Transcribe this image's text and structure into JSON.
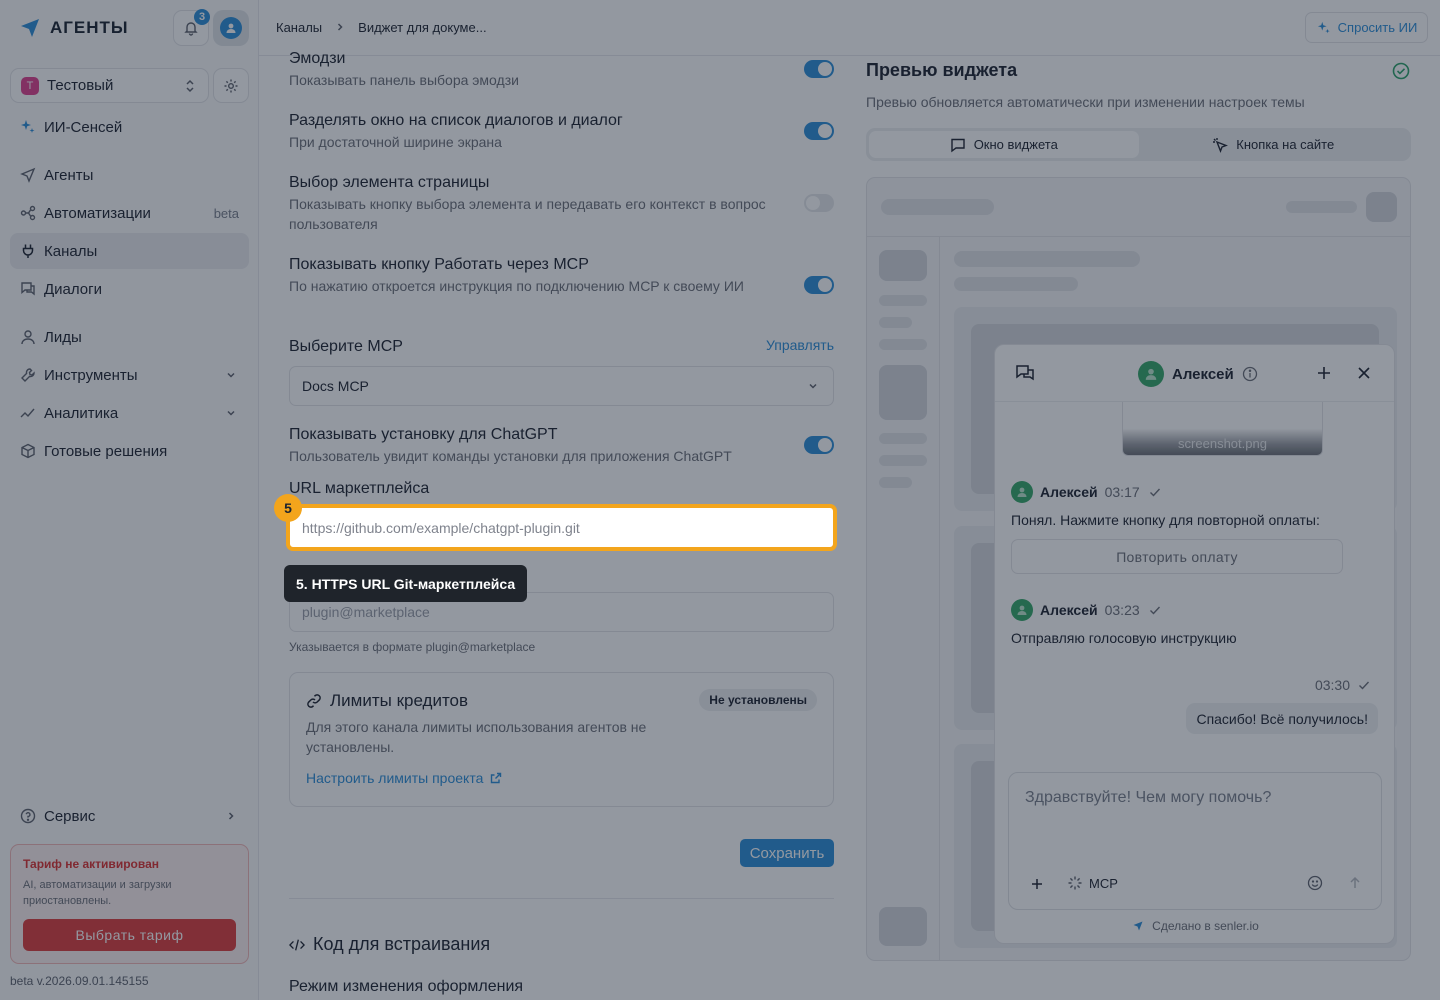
{
  "brand": {
    "name": "АГЕНТЫ",
    "notifications_count": "3"
  },
  "project": {
    "letter": "Т",
    "name": "Тестовый"
  },
  "sidebar": {
    "ai_item": "ИИ-Сенсей",
    "items": [
      {
        "label": "Агенты",
        "icon": "agent-icon"
      },
      {
        "label": "Автоматизации",
        "tag": "beta",
        "icon": "automation-icon"
      },
      {
        "label": "Каналы",
        "icon": "plug-icon",
        "active": true
      },
      {
        "label": "Диалоги",
        "icon": "chat-icon"
      },
      {
        "label": "Лиды",
        "icon": "user-icon"
      },
      {
        "label": "Инструменты",
        "icon": "tools-icon"
      },
      {
        "label": "Аналитика",
        "icon": "analytics-icon"
      },
      {
        "label": "Готовые решения",
        "icon": "box-icon"
      }
    ],
    "service": "Сервис",
    "tariff": {
      "title": "Тариф не активирован",
      "text": "AI, автоматизации и загрузки приостановлены.",
      "button": "Выбрать тариф"
    },
    "version": "beta v.2026.09.01.145155"
  },
  "topbar": {
    "breadcrumb": [
      "Каналы",
      "Виджет для докуме..."
    ],
    "ask_ai": "Спросить ИИ"
  },
  "settings": {
    "emoji": {
      "title": "Эмодзи",
      "desc": "Показывать панель выбора эмодзи",
      "on": true
    },
    "split": {
      "title": "Разделять окно на список диалогов и диалог",
      "desc": "При достаточной ширине экрана",
      "on": true
    },
    "element_pick": {
      "title": "Выбор элемента страницы",
      "desc": "Показывать кнопку выбора элемента и передавать его контекст в вопрос пользователя",
      "on": false
    },
    "mcp_button": {
      "title": "Показывать кнопку Работать через MCP",
      "desc": "По нажатию откроется инструкция по подключению MCP к своему ИИ",
      "on": true
    },
    "mcp_select": {
      "label": "Выберите MCP",
      "manage": "Управлять",
      "value": "Docs MCP"
    },
    "chatgpt": {
      "title": "Показывать установку для ChatGPT",
      "desc": "Пользователь увидит команды установки для приложения ChatGPT",
      "on": true
    },
    "marketplace_url": {
      "label": "URL маркетплейса",
      "placeholder": "https://github.com/example/chatgpt-plugin.git"
    },
    "plugin": {
      "placeholder": "plugin@marketplace",
      "hint": "Указывается в формате plugin@marketplace"
    },
    "limits": {
      "title": "Лимиты кредитов",
      "badge": "Не установлены",
      "desc": "Для этого канала лимиты использования агентов не установлены.",
      "link": "Настроить лимиты проекта"
    },
    "save": "Сохранить",
    "embed_title": "Код для встраивания",
    "mode_title": "Режим изменения оформления"
  },
  "preview": {
    "title": "Превью виджета",
    "desc": "Превью обновляется автоматически при изменении настроек темы",
    "tabs": [
      "Окно виджета",
      "Кнопка на сайте"
    ],
    "widget": {
      "agent_name": "Алексей",
      "attachment": "screenshot.png",
      "messages": [
        {
          "author": "Алексей",
          "time": "03:17",
          "text": "Понял. Нажмите кнопку для повторной оплаты:"
        },
        {
          "author": "Алексей",
          "time": "03:23",
          "text": "Отправляю голосовую инструкцию"
        }
      ],
      "retry_button": "Повторить оплату",
      "my_time": "03:30",
      "my_message": "Спасибо! Всё получилось!",
      "composer_placeholder": "Здравствуйте! Чем могу помочь?",
      "mcp": "MCP",
      "made_with": "Сделано в senler.io"
    }
  },
  "tour": {
    "step": "5",
    "tooltip": "5. HTTPS URL Git-маркетплейса"
  },
  "colors": {
    "accent": "#2d8fd9",
    "highlight": "#f3a51c",
    "danger": "#de3d3d"
  }
}
